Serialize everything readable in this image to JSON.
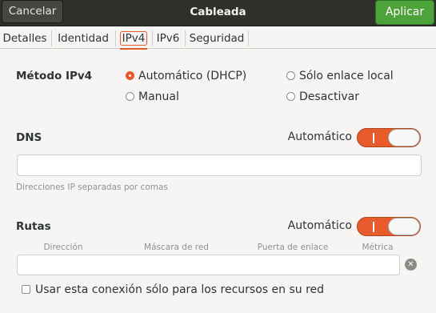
{
  "header": {
    "cancel_label": "Cancelar",
    "title": "Cableada",
    "apply_label": "Aplicar"
  },
  "tabs": [
    {
      "label": "Detalles",
      "active": false
    },
    {
      "label": "Identidad",
      "active": false
    },
    {
      "label": "IPv4",
      "active": true
    },
    {
      "label": "IPv6",
      "active": false
    },
    {
      "label": "Seguridad",
      "active": false
    }
  ],
  "method": {
    "label": "Método IPv4",
    "options": [
      {
        "label": "Automático (DHCP)",
        "checked": true
      },
      {
        "label": "Sólo enlace local",
        "checked": false
      },
      {
        "label": "Manual",
        "checked": false
      },
      {
        "label": "Desactivar",
        "checked": false
      }
    ]
  },
  "dns": {
    "label": "DNS",
    "auto_label": "Automático",
    "auto_on": true,
    "value": "",
    "hint": "Direcciones IP separadas por comas"
  },
  "routes": {
    "label": "Rutas",
    "auto_label": "Automático",
    "auto_on": true,
    "columns": [
      "Dirección",
      "Máscara de red",
      "Puerta de enlace",
      "Métrica"
    ],
    "row": [
      "",
      "",
      "",
      ""
    ],
    "clear_icon": "clear-icon"
  },
  "only_local_resources": {
    "label": "Usar esta conexión sólo para los recursos en su red",
    "checked": false
  },
  "colors": {
    "accent": "#e9582b",
    "apply_green": "#4ea23a",
    "headerbar": "#2f2f2c"
  }
}
